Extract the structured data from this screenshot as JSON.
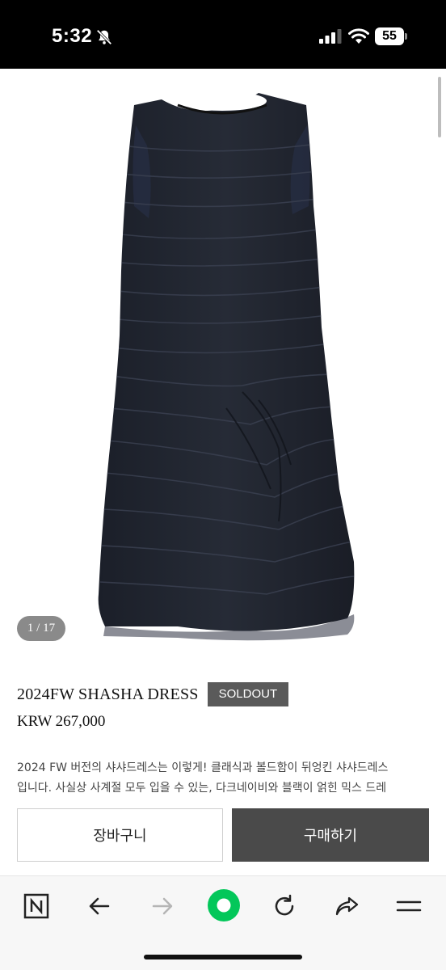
{
  "status_bar": {
    "time": "5:32",
    "battery": "55",
    "icons": [
      "bell-off-icon",
      "signal-icon",
      "wifi-icon",
      "battery-icon"
    ]
  },
  "gallery": {
    "counter": "1 / 17",
    "image": "black-tiered-sleeveless-dress"
  },
  "product": {
    "title": "2024FW SHASHA DRESS",
    "badge": "SOLDOUT",
    "price": "KRW 267,000",
    "description_lines": [
      "2024 FW 버전의 샤샤드레스는 이렇게! 클래식과 볼드함이 뒤엉킨 샤샤드레스",
      "입니다. 사실상 사계절 모두 입을 수 있는, 다크네이비와 블랙이 얽힌 믹스 드레"
    ]
  },
  "actions": {
    "cart_label": "장바구니",
    "buy_label": "구매하기"
  },
  "browser_toolbar": {
    "items": [
      "naver-n-icon",
      "back-arrow-icon",
      "forward-arrow-icon",
      "green-home-icon",
      "reload-icon",
      "share-icon",
      "menu-icon"
    ],
    "accent": "#03c75a"
  },
  "colors": {
    "badge_bg": "#5a5a5a",
    "buy_bg": "#4a4a4a",
    "counter_bg": "#8a8a8a"
  }
}
